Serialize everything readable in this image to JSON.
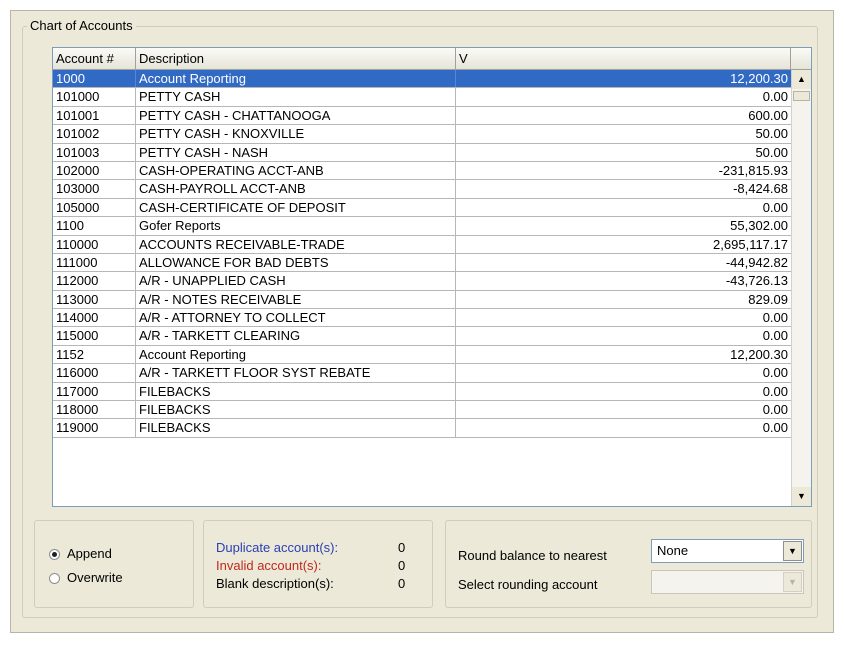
{
  "group": {
    "title": "Chart of Accounts"
  },
  "grid": {
    "columns": [
      "Account #",
      "Description",
      "V"
    ],
    "selected_index": 0,
    "rows": [
      {
        "account": "1000",
        "description": "Account Reporting",
        "value": "12,200.30"
      },
      {
        "account": "101000",
        "description": "PETTY CASH",
        "value": "0.00"
      },
      {
        "account": "101001",
        "description": "PETTY CASH - CHATTANOOGA",
        "value": "600.00"
      },
      {
        "account": "101002",
        "description": "PETTY CASH - KNOXVILLE",
        "value": "50.00"
      },
      {
        "account": "101003",
        "description": "PETTY CASH - NASH",
        "value": "50.00"
      },
      {
        "account": "102000",
        "description": "CASH-OPERATING ACCT-ANB",
        "value": "-231,815.93"
      },
      {
        "account": "103000",
        "description": "CASH-PAYROLL ACCT-ANB",
        "value": "-8,424.68"
      },
      {
        "account": "105000",
        "description": "CASH-CERTIFICATE OF DEPOSIT",
        "value": "0.00"
      },
      {
        "account": "1100",
        "description": "Gofer Reports",
        "value": "55,302.00"
      },
      {
        "account": "110000",
        "description": "ACCOUNTS RECEIVABLE-TRADE",
        "value": "2,695,117.17"
      },
      {
        "account": "111000",
        "description": "ALLOWANCE FOR BAD DEBTS",
        "value": "-44,942.82"
      },
      {
        "account": "112000",
        "description": "A/R - UNAPPLIED CASH",
        "value": "-43,726.13"
      },
      {
        "account": "113000",
        "description": "A/R - NOTES RECEIVABLE",
        "value": "829.09"
      },
      {
        "account": "114000",
        "description": "A/R - ATTORNEY TO COLLECT",
        "value": "0.00"
      },
      {
        "account": "115000",
        "description": "A/R - TARKETT CLEARING",
        "value": "0.00"
      },
      {
        "account": "1152",
        "description": "Account Reporting",
        "value": "12,200.30"
      },
      {
        "account": "116000",
        "description": "A/R - TARKETT FLOOR SYST REBATE",
        "value": "0.00"
      },
      {
        "account": "117000",
        "description": "FILEBACKS",
        "value": "0.00"
      },
      {
        "account": "118000",
        "description": "FILEBACKS",
        "value": "0.00"
      },
      {
        "account": "119000",
        "description": "FILEBACKS",
        "value": "0.00"
      }
    ]
  },
  "mode": {
    "options": [
      "Append",
      "Overwrite"
    ],
    "selected": "Append"
  },
  "stats": {
    "duplicate_label": "Duplicate account(s):",
    "duplicate_count": "0",
    "invalid_label": "Invalid account(s):",
    "invalid_count": "0",
    "blank_label": "Blank description(s):",
    "blank_count": "0"
  },
  "rounding": {
    "round_label": "Round balance to nearest",
    "round_value": "None",
    "account_label": "Select rounding account",
    "account_value": ""
  },
  "colors": {
    "selection": "#316ac5",
    "duplicate": "#2b3fb3",
    "invalid": "#c0281f"
  }
}
